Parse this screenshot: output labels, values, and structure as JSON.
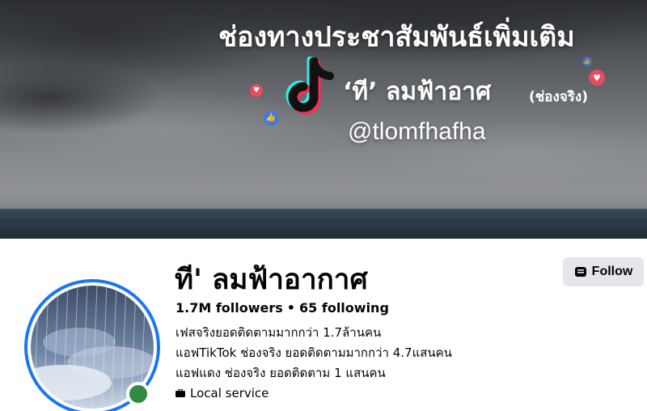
{
  "cover": {
    "headline": "ช่องทางประชาสัมพันธ์เพิ่มเติม",
    "page_name": "‘ที’ ลมฟ้าอาศ",
    "page_tag": "(ช่องจริง)",
    "handle": "@tlomfhafha"
  },
  "profile": {
    "name": "ที' ลมฟ้าอากาศ",
    "followers": "1.7M followers",
    "separator": "•",
    "following": "65 following",
    "bio": [
      "เฟสจริงยอดติดตามมากกว่า 1.7ล้านคน",
      "แอฟTikTok ช่องจริง ยอดติดตามมากกว่า 4.7แสนคน",
      "แอฟแดง ช่องจริง ยอดติดตาม 1 แสนคน"
    ],
    "category": "Local service",
    "online_status_color": "#2e8b3f"
  },
  "actions": {
    "follow_label": "Follow"
  },
  "colors": {
    "accent_blue": "#1877f2",
    "button_bg": "#e4e6eb"
  }
}
